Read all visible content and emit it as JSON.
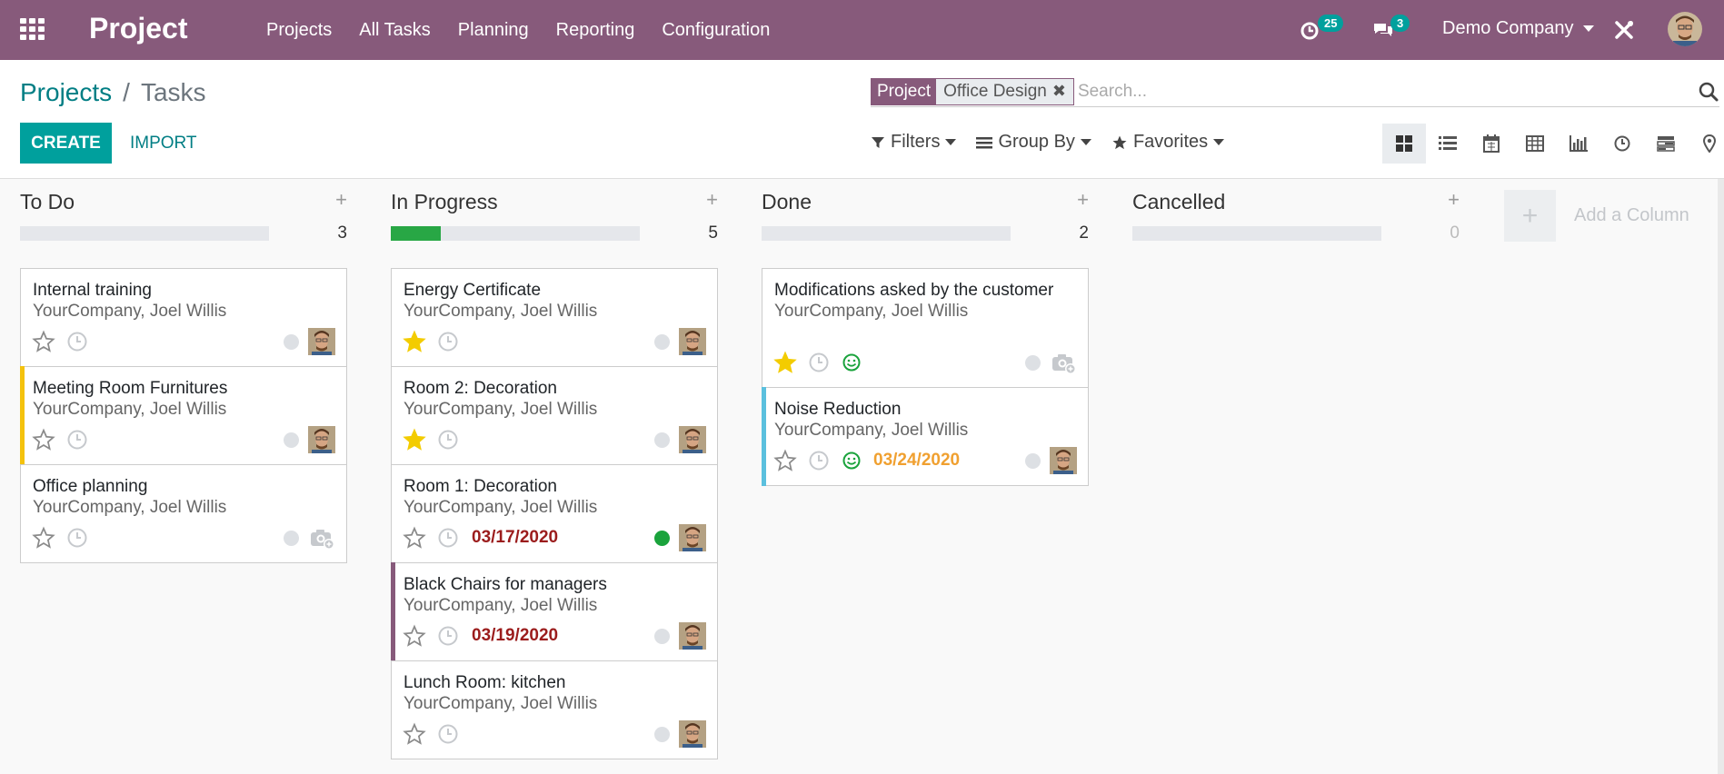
{
  "navbar": {
    "brand": "Project",
    "menu": [
      "Projects",
      "All Tasks",
      "Planning",
      "Reporting",
      "Configuration"
    ],
    "activity_count": "25",
    "message_count": "3",
    "company": "Demo Company"
  },
  "control_panel": {
    "breadcrumb": {
      "parent": "Projects",
      "separator": "/",
      "current": "Tasks"
    },
    "search": {
      "facet_label": "Project",
      "facet_value": "Office Design",
      "facet_remove": "✖",
      "placeholder": "Search..."
    },
    "create_label": "CREATE",
    "import_label": "IMPORT",
    "filters_label": "Filters",
    "groupby_label": "Group By",
    "favorites_label": "Favorites",
    "views": [
      "kanban",
      "list",
      "calendar",
      "pivot",
      "graph",
      "activity",
      "gantt",
      "map"
    ]
  },
  "kanban": {
    "columns": [
      {
        "title": "To Do",
        "add": "+",
        "count": "3",
        "progress_done": 0,
        "cards": [
          {
            "title": "Internal training",
            "subtitle": "YourCompany, Joel Willis",
            "starred": false,
            "accent": "",
            "date": "",
            "date_color": "",
            "smile": false,
            "state": "normal",
            "user": true
          },
          {
            "title": "Meeting Room Furnitures",
            "subtitle": "YourCompany, Joel Willis",
            "starred": false,
            "accent": "#f4c20d",
            "date": "",
            "date_color": "",
            "smile": false,
            "state": "normal",
            "user": true
          },
          {
            "title": "Office planning",
            "subtitle": "YourCompany, Joel Willis",
            "starred": false,
            "accent": "",
            "date": "",
            "date_color": "",
            "smile": false,
            "state": "normal",
            "user": false
          }
        ]
      },
      {
        "title": "In Progress",
        "add": "+",
        "count": "5",
        "progress_done": 0.2,
        "cards": [
          {
            "title": "Energy Certificate",
            "subtitle": "YourCompany, Joel Willis",
            "starred": true,
            "accent": "",
            "date": "",
            "date_color": "",
            "smile": false,
            "state": "normal",
            "user": true
          },
          {
            "title": "Room 2: Decoration",
            "subtitle": "YourCompany, Joel Willis",
            "starred": true,
            "accent": "",
            "date": "",
            "date_color": "",
            "smile": false,
            "state": "normal",
            "user": true
          },
          {
            "title": "Room 1: Decoration",
            "subtitle": "YourCompany, Joel Willis",
            "starred": false,
            "accent": "",
            "date": "03/17/2020",
            "date_color": "red",
            "smile": false,
            "state": "done",
            "user": true
          },
          {
            "title": "Black Chairs for managers",
            "subtitle": "YourCompany, Joel Willis",
            "starred": false,
            "accent": "#875a7b",
            "date": "03/19/2020",
            "date_color": "red",
            "smile": false,
            "state": "normal",
            "user": true
          },
          {
            "title": "Lunch Room: kitchen",
            "subtitle": "YourCompany, Joel Willis",
            "starred": false,
            "accent": "",
            "date": "",
            "date_color": "",
            "smile": false,
            "state": "normal",
            "user": true
          }
        ]
      },
      {
        "title": "Done",
        "add": "+",
        "count": "2",
        "progress_done": 0,
        "cards": [
          {
            "title": "Modifications asked by the customer",
            "subtitle": "YourCompany, Joel Willis",
            "starred": true,
            "accent": "",
            "date": "",
            "date_color": "",
            "smile": true,
            "state": "normal",
            "user": false,
            "tall": true
          },
          {
            "title": "Noise Reduction",
            "subtitle": "YourCompany, Joel Willis",
            "starred": false,
            "accent": "#5bc0de",
            "date": "03/24/2020",
            "date_color": "orange",
            "smile": true,
            "state": "normal",
            "user": true
          }
        ]
      },
      {
        "title": "Cancelled",
        "add": "+",
        "count": "0",
        "progress_done": 0,
        "cards": []
      }
    ],
    "add_column_label": "Add a Column",
    "add_column_icon": "+"
  }
}
